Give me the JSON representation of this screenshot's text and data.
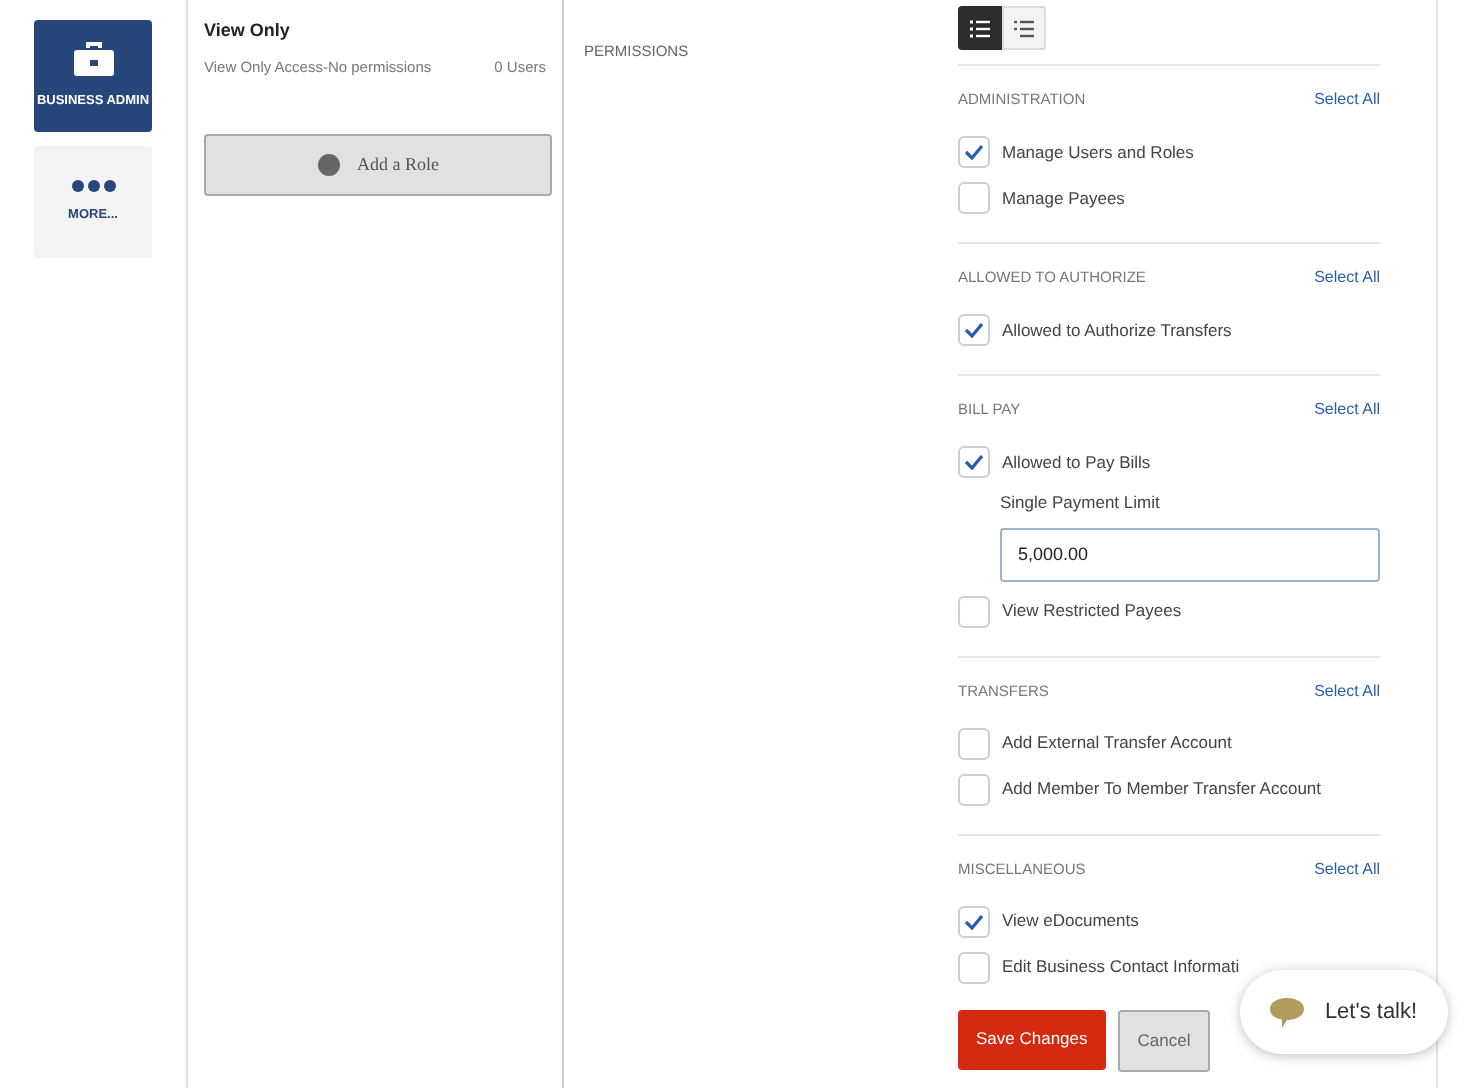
{
  "sidebar": {
    "items": [
      {
        "label": "BUSINESS ADMIN",
        "kind": "briefcase",
        "selected": true
      },
      {
        "label": "MORE...",
        "kind": "dots",
        "selected": false
      }
    ]
  },
  "roles": {
    "items": [
      {
        "name": "View Only",
        "description": "View Only Access-No permissions",
        "count": "0 Users"
      }
    ],
    "add_button": "Add a Role"
  },
  "permissions": {
    "label": "PERMISSIONS",
    "view_toggle": [
      {
        "kind": "list",
        "selected": true
      },
      {
        "kind": "tree",
        "selected": false
      }
    ],
    "sections": [
      {
        "title": "ADMINISTRATION",
        "select_all": "Select All",
        "items": [
          {
            "label": "Manage Users and Roles",
            "checked": true
          },
          {
            "label": "Manage Payees",
            "checked": false
          }
        ]
      },
      {
        "title": "ALLOWED TO AUTHORIZE",
        "select_all": "Select All",
        "items": [
          {
            "label": "Allowed to Authorize Transfers",
            "checked": true
          }
        ]
      },
      {
        "title": "BILL PAY",
        "select_all": "Select All",
        "items": [
          {
            "label": "Allowed to Pay Bills",
            "checked": true,
            "limit": {
              "label": "Single Payment Limit",
              "value": "5,000.00"
            }
          },
          {
            "label": "View Restricted Payees",
            "checked": false
          }
        ]
      },
      {
        "title": "TRANSFERS",
        "select_all": "Select All",
        "items": [
          {
            "label": "Add External Transfer Account",
            "checked": false
          },
          {
            "label": "Add Member To Member Transfer Account",
            "checked": false
          }
        ]
      },
      {
        "title": "MISCELLANEOUS",
        "select_all": "Select All",
        "items": [
          {
            "label": "View eDocuments",
            "checked": true
          },
          {
            "label": "Edit Business Contact Informati",
            "checked": false
          }
        ]
      }
    ],
    "buttons": [
      {
        "label": "Save Changes",
        "kind": "primary"
      },
      {
        "label": "Cancel",
        "kind": "secondary"
      }
    ]
  },
  "chat": {
    "label": "Let's talk!"
  }
}
